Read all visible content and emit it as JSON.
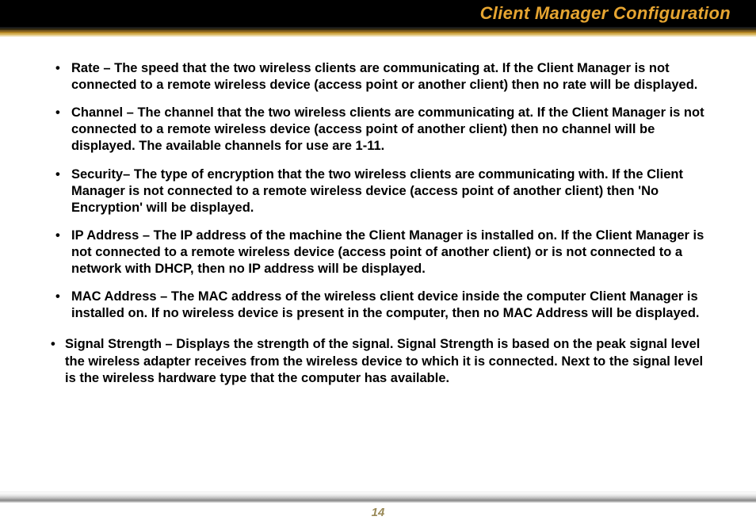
{
  "header": {
    "title": "Client Manager Configuration"
  },
  "items": [
    {
      "term": "Rate – ",
      "desc": "The speed that the two wireless clients are communicating at.  If the Client Manager is not connected to a remote wireless device (access point or another client) then no rate will be displayed."
    },
    {
      "term": "Channel – ",
      "desc": "The channel that the two wireless clients are communicating at.  If the Client Manager is not connected to a remote wireless device (access point of another client) then no channel will be displayed.  The available channels for use are 1-11."
    },
    {
      "term": "Security– ",
      "desc": "The type of encryption that the two wireless clients are communicating with.  If the Client Manager is not connected to a remote wireless device (access point of another client) then 'No Encryption' will be displayed."
    },
    {
      "term": "IP Address – ",
      "desc": "The IP address of the machine the Client Manager is installed on.  If the Client Manager is not connected to a remote wireless device (access point of another client) or is not connected to a network with DHCP, then no IP address will be displayed."
    },
    {
      "term": "MAC Address – ",
      "desc": "The MAC address of the wireless client device inside the computer Client Manager is installed on. If no wireless device is present in the computer, then no MAC Address will be displayed."
    },
    {
      "term": "Signal Strength – ",
      "desc": "Displays the strength of the signal. Signal Strength is based on the peak signal level the wireless adapter receives from the wireless device to which it is connected.  Next to the signal level is the wireless hardware type that the computer has available."
    }
  ],
  "footer": {
    "page": "14"
  }
}
